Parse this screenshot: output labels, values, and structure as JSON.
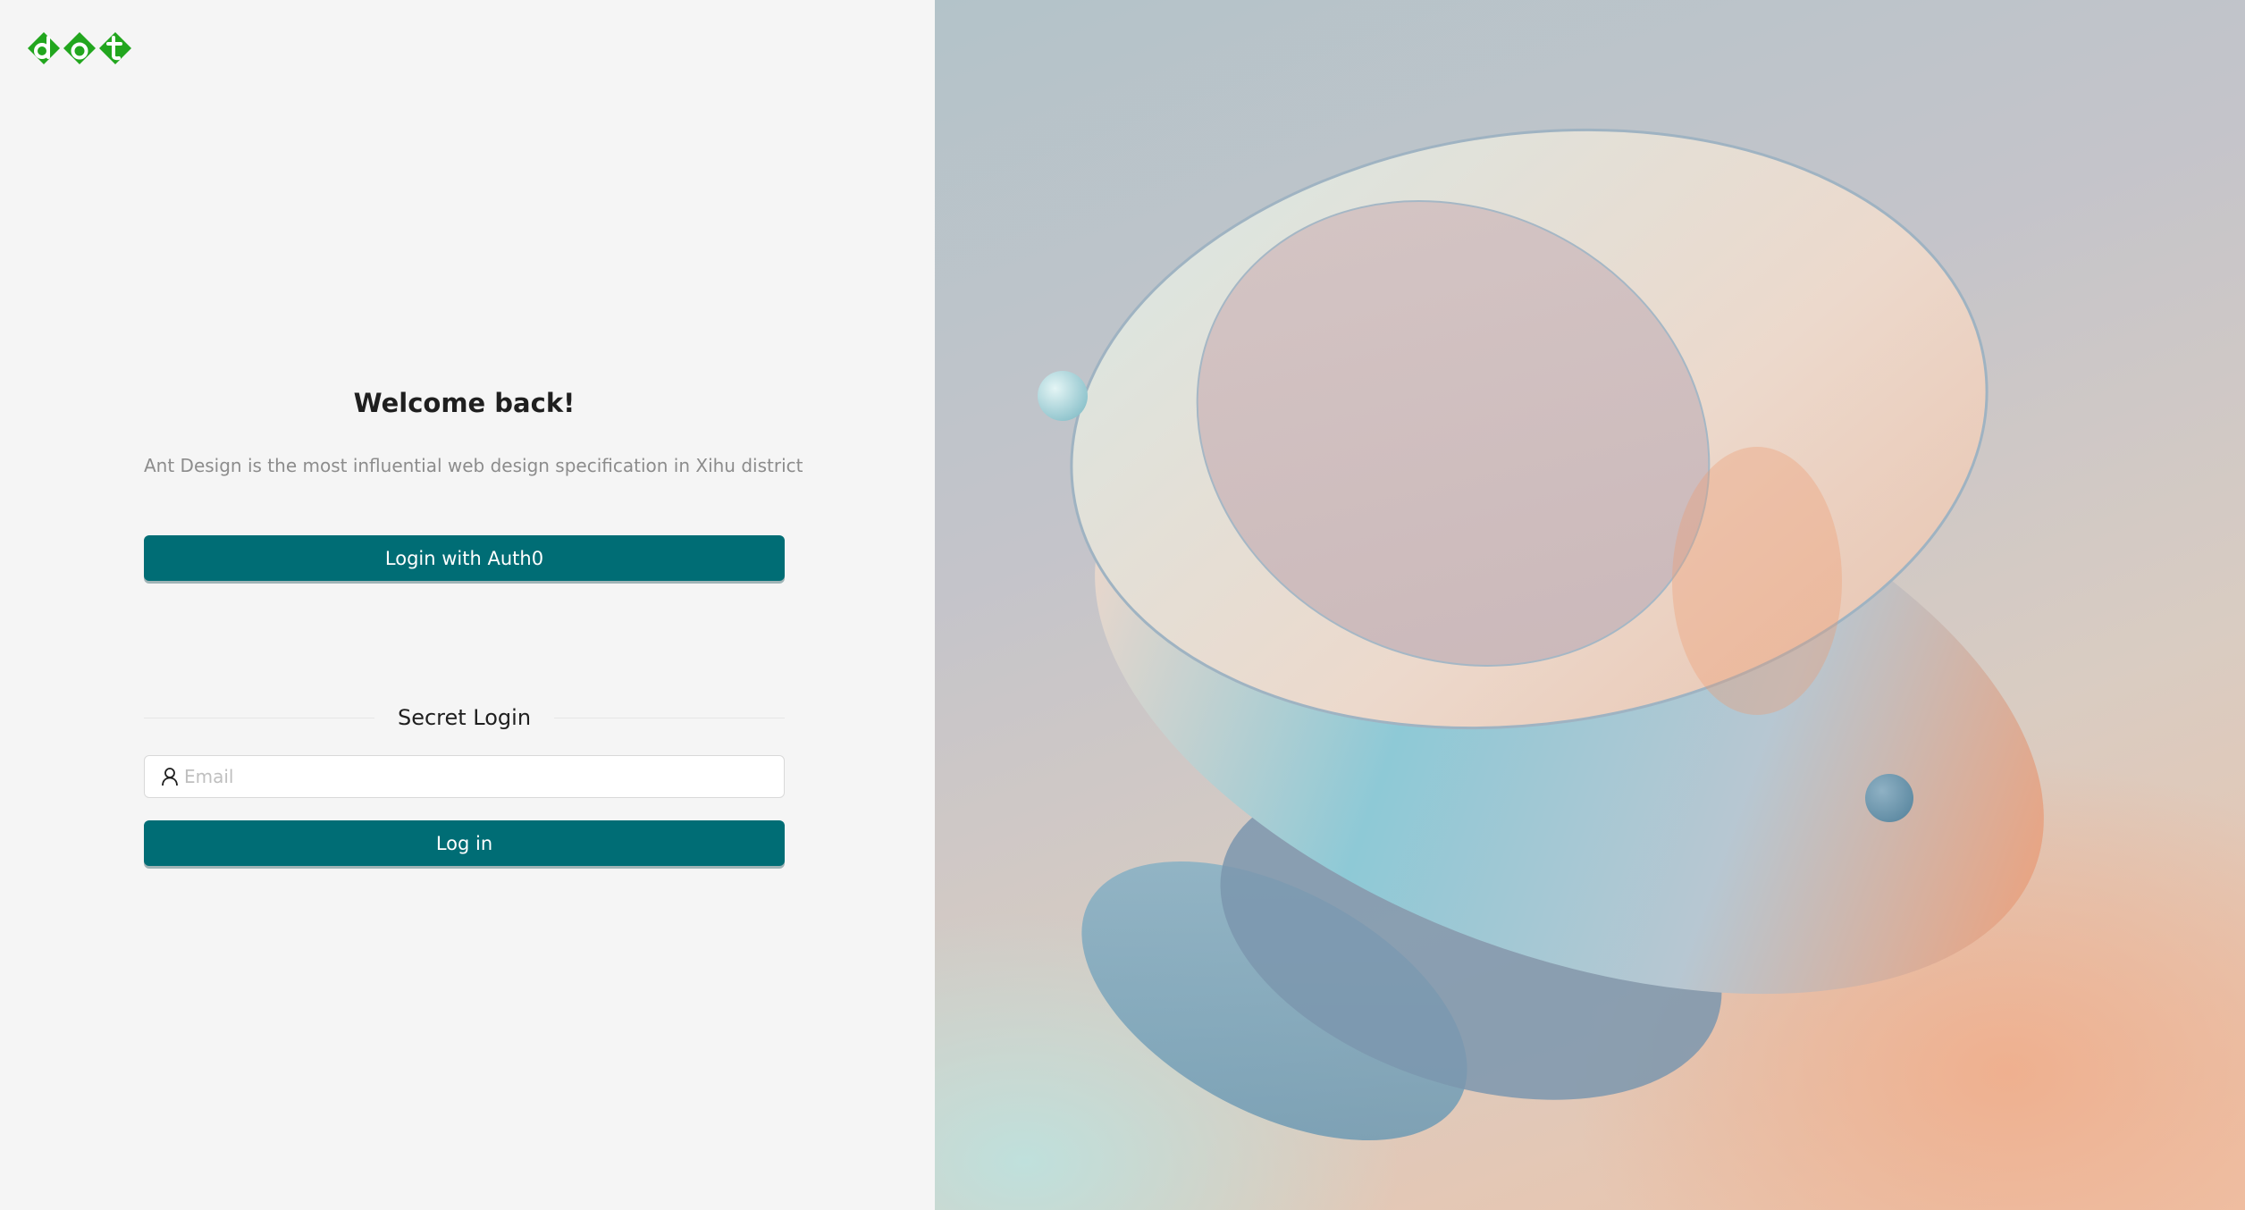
{
  "brand": {
    "logo_text": "dot",
    "logo_color": "#22a61e"
  },
  "login": {
    "title": "Welcome back!",
    "subtitle": "Ant Design is the most influential web design specification in Xihu district",
    "auth0_button_label": "Login with Auth0",
    "divider_label": "Secret Login",
    "email_placeholder": "Email",
    "email_value": "",
    "email_icon": "user-icon",
    "login_button_label": "Log in"
  },
  "colors": {
    "primary": "#006d75",
    "background": "#f5f5f5",
    "text": "#1f1f1f",
    "muted_text": "#8c8c8c"
  }
}
